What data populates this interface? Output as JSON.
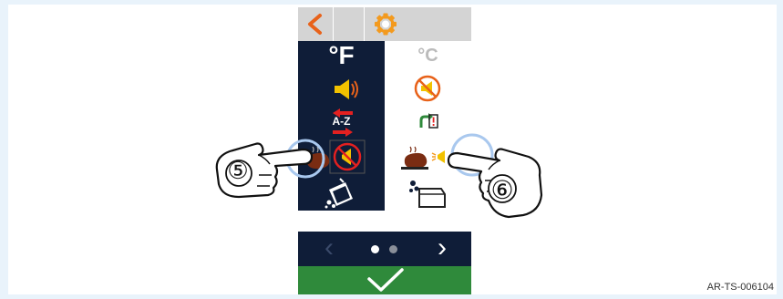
{
  "toolbar": {
    "back_icon": "back-arrow-icon",
    "settings_icon": "gear-icon",
    "accent_color": "#e8621a"
  },
  "settings": {
    "unit_f_label": "°F",
    "unit_c_label": "°C",
    "sound_on_icon": "speaker-on-icon",
    "sound_off_icon": "speaker-off-icon",
    "sort_az_label": "A-Z",
    "sort_icon": "sort-alphabetical-icon",
    "export_icon": "export-alert-icon",
    "cook_sound_off_icon": "cooking-sound-off-icon",
    "cook_sound_on_icon": "cooking-sound-on-icon",
    "cleaning_tablet_icon": "cleaning-tablet-icon",
    "cleaning_container_icon": "cleaning-container-icon"
  },
  "pager": {
    "prev_label": "‹",
    "next_label": "›",
    "active_page": 1,
    "page_count": 2
  },
  "confirm": {
    "icon": "checkmark-icon",
    "color": "#2f8a3b"
  },
  "callouts": {
    "left_number": "⑤",
    "right_number": "⑥"
  },
  "reference_code": "AR-TS-006104"
}
